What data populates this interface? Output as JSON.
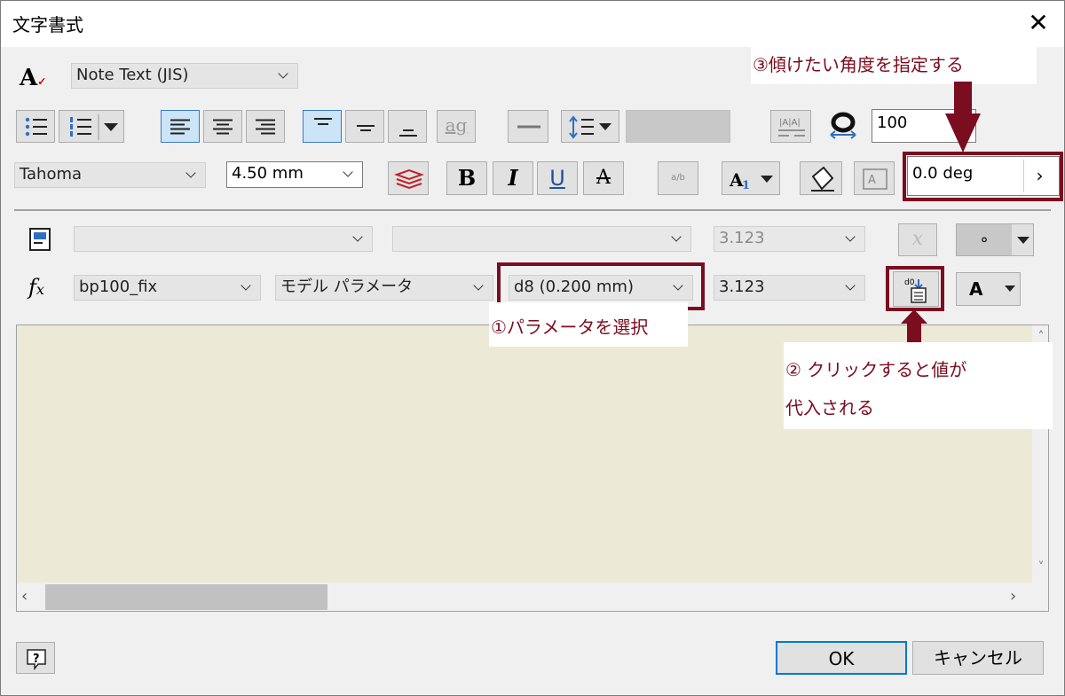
{
  "window": {
    "title": "文字書式"
  },
  "style_combo": {
    "value": "Note Text (JIS)"
  },
  "font_combo": {
    "value": "Tahoma"
  },
  "size_combo": {
    "value": "4.50 mm"
  },
  "width_scale_input": {
    "value": "100"
  },
  "rotation_input": {
    "value": "0.0 deg"
  },
  "buttons": {
    "bold": "B",
    "italic": "I",
    "underline": "U",
    "strike": "A",
    "ag": "ag",
    "font_color_letter": "A",
    "ok": "OK",
    "cancel": "キャンセル"
  },
  "param_row1": {
    "combo3": "3.123"
  },
  "param_row2": {
    "component": "bp100_fix",
    "type": "モデル パラメータ",
    "parameter": "d8 (0.200 mm)",
    "precision": "3.123"
  },
  "symbol_sample": "∘",
  "annotations": {
    "step1": "①パラメータを選択",
    "step2_line1": "② クリックすると値が",
    "step2_line2": "代入される",
    "step3": "③傾けたい角度を指定する"
  },
  "icons": [
    "close-icon",
    "text-style-icon",
    "bullet-list-icon",
    "numbered-list-icon",
    "align-left-icon",
    "align-center-icon",
    "align-right-icon",
    "valign-top-icon",
    "valign-middle-icon",
    "valign-bottom-icon",
    "line-icon",
    "line-spacing-icon",
    "character-spacing-icon",
    "width-scale-icon",
    "stack-icon",
    "insert-symbol-icon",
    "background-fill-icon",
    "frame-icon",
    "component-icon",
    "function-icon",
    "insert-parameter-icon",
    "help-icon",
    "scroll-up-icon",
    "scroll-down-icon",
    "scroll-left-icon",
    "scroll-right-icon"
  ],
  "colors": {
    "annotation": "#7b0d20",
    "editor_bg": "#ece9d6",
    "selected_button": "#cce4f7"
  }
}
